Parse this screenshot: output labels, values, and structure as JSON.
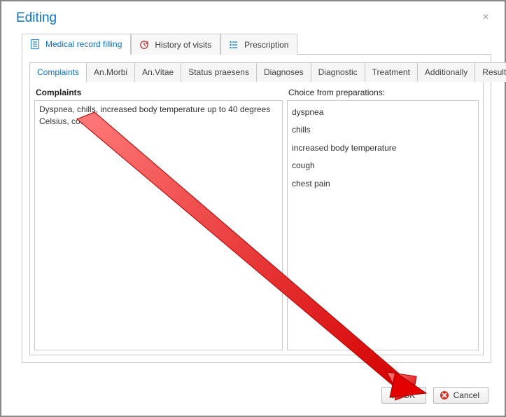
{
  "window": {
    "title": "Editing"
  },
  "topTabs": [
    {
      "label": "Medical record filling"
    },
    {
      "label": "History of visits"
    },
    {
      "label": "Prescription"
    }
  ],
  "subTabs": [
    {
      "label": "Complaints"
    },
    {
      "label": "An.Morbi"
    },
    {
      "label": "An.Vitae"
    },
    {
      "label": "Status praesens"
    },
    {
      "label": "Diagnoses"
    },
    {
      "label": "Diagnostic"
    },
    {
      "label": "Treatment"
    },
    {
      "label": "Additionally"
    },
    {
      "label": "Result"
    }
  ],
  "left": {
    "heading": "Complaints",
    "text": "Dyspnea, chills, increased body temperature up to 40 degrees Celsius, cough"
  },
  "right": {
    "heading": "Choice from preparations:",
    "items": [
      "dyspnea",
      "chills",
      "increased body temperature",
      "cough",
      "chest pain"
    ]
  },
  "buttons": {
    "ok": "OK",
    "cancel": "Cancel"
  }
}
